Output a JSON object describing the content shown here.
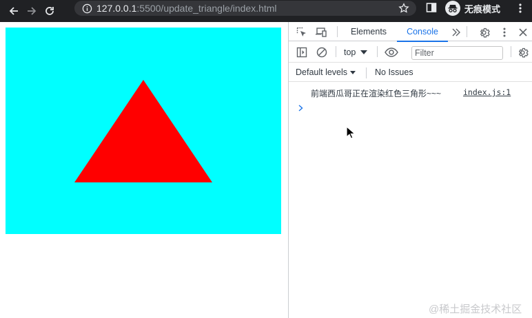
{
  "browser": {
    "url_host": "127.0.0.1",
    "url_path": ":5500/update_triangle/index.html",
    "incognito_label": "无痕模式"
  },
  "page": {
    "canvas_background": "#00ffff",
    "triangle_color": "#ff0000"
  },
  "devtools": {
    "tabs": [
      {
        "label": "Elements",
        "active": false
      },
      {
        "label": "Console",
        "active": true
      }
    ],
    "toolbar": {
      "context": "top",
      "filter_placeholder": "Filter"
    },
    "levels": {
      "label": "Default levels",
      "issues": "No Issues"
    },
    "console": {
      "messages": [
        {
          "text": "前端西瓜哥正在渲染红色三角形~~~",
          "source": "index.js:1"
        }
      ]
    },
    "accent_color": "#1a73e8"
  },
  "watermark": "@稀土掘金技术社区"
}
